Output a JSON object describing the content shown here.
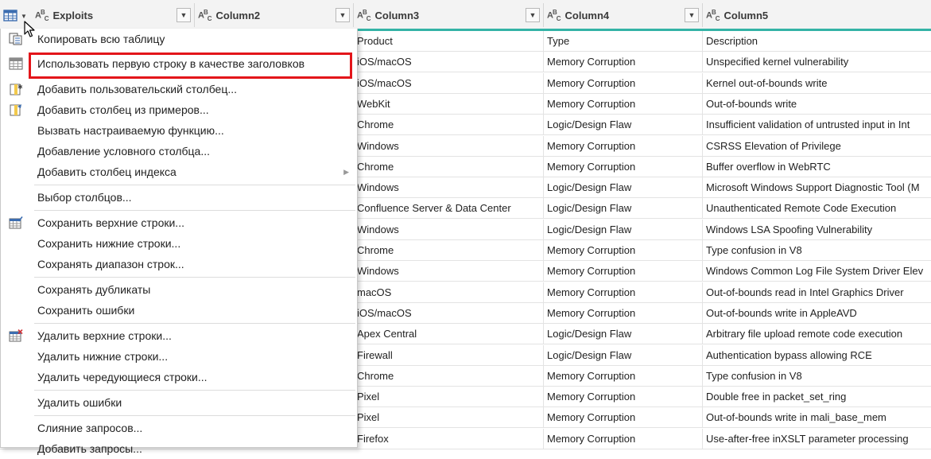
{
  "columns": [
    {
      "name": "Exploits",
      "type_icon": "abc-type-icon"
    },
    {
      "name": "Column2",
      "type_icon": "abc-type-icon"
    },
    {
      "name": "Column3",
      "type_icon": "abc-type-icon"
    },
    {
      "name": "Column4",
      "type_icon": "abc-type-icon"
    },
    {
      "name": "Column5",
      "type_icon": "abc-type-icon"
    }
  ],
  "rows": [
    [
      "Product",
      "Type",
      "Description"
    ],
    [
      "iOS/macOS",
      "Memory Corruption",
      "Unspecified kernel vulnerability"
    ],
    [
      "iOS/macOS",
      "Memory Corruption",
      "Kernel out-of-bounds write"
    ],
    [
      "WebKit",
      "Memory Corruption",
      "Out-of-bounds write"
    ],
    [
      "Chrome",
      "Logic/Design Flaw",
      "Insufficient validation of untrusted input in Int"
    ],
    [
      "Windows",
      "Memory Corruption",
      "CSRSS Elevation of Privilege"
    ],
    [
      "Chrome",
      "Memory Corruption",
      "Buffer overflow in WebRTC"
    ],
    [
      "Windows",
      "Logic/Design Flaw",
      "Microsoft Windows Support Diagnostic Tool (M"
    ],
    [
      "Confluence Server & Data Center",
      "Logic/Design Flaw",
      "Unauthenticated Remote Code Execution"
    ],
    [
      "Windows",
      "Logic/Design Flaw",
      "Windows LSA Spoofing Vulnerability"
    ],
    [
      "Chrome",
      "Memory Corruption",
      "Type confusion in V8"
    ],
    [
      "Windows",
      "Memory Corruption",
      "Windows Common Log File System Driver Elev"
    ],
    [
      "macOS",
      "Memory Corruption",
      "Out-of-bounds read in Intel Graphics Driver"
    ],
    [
      "iOS/macOS",
      "Memory Corruption",
      "Out-of-bounds write in AppleAVD"
    ],
    [
      "Apex Central",
      "Logic/Design Flaw",
      "Arbitrary file upload remote code execution"
    ],
    [
      "Firewall",
      "Logic/Design Flaw",
      "Authentication bypass allowing RCE"
    ],
    [
      "Chrome",
      "Memory Corruption",
      "Type confusion in V8"
    ],
    [
      "Pixel",
      "Memory Corruption",
      "Double free in packet_set_ring"
    ],
    [
      "Pixel",
      "Memory Corruption",
      "Out-of-bounds write in mali_base_mem"
    ],
    [
      "Firefox",
      "Memory Corruption",
      "Use-after-free inXSLT parameter processing"
    ]
  ],
  "menu": {
    "items": [
      {
        "label": "Копировать всю таблицу",
        "icon": "copy-table-icon"
      },
      {
        "label": "Использовать первую строку в качестве заголовков",
        "icon": "table-header-icon",
        "highlighted": true
      },
      {
        "label": "Добавить пользовательский столбец...",
        "icon": "custom-column-icon"
      },
      {
        "label": "Добавить столбец из примеров...",
        "icon": "column-from-examples-icon"
      },
      {
        "label": "Вызвать настраиваемую функцию...",
        "icon": ""
      },
      {
        "label": "Добавление условного столбца...",
        "icon": ""
      },
      {
        "label": "Добавить столбец индекса",
        "icon": "",
        "submenu": true
      },
      {
        "label": "Выбор столбцов...",
        "icon": ""
      },
      {
        "label": "Сохранить верхние строки...",
        "icon": "keep-rows-icon"
      },
      {
        "label": "Сохранить нижние строки...",
        "icon": ""
      },
      {
        "label": "Сохранять диапазон строк...",
        "icon": ""
      },
      {
        "label": "Сохранять дубликаты",
        "icon": ""
      },
      {
        "label": "Сохранить ошибки",
        "icon": ""
      },
      {
        "label": "Удалить верхние строки...",
        "icon": "remove-rows-icon"
      },
      {
        "label": "Удалить нижние строки...",
        "icon": ""
      },
      {
        "label": "Удалить чередующиеся строки...",
        "icon": ""
      },
      {
        "label": "Удалить ошибки",
        "icon": ""
      },
      {
        "label": "Слияние запросов...",
        "icon": ""
      },
      {
        "label": "Добавить запросы...",
        "icon": ""
      }
    ]
  },
  "colors": {
    "accent_teal": "#33b3a6",
    "highlight_red": "#e3151a"
  }
}
